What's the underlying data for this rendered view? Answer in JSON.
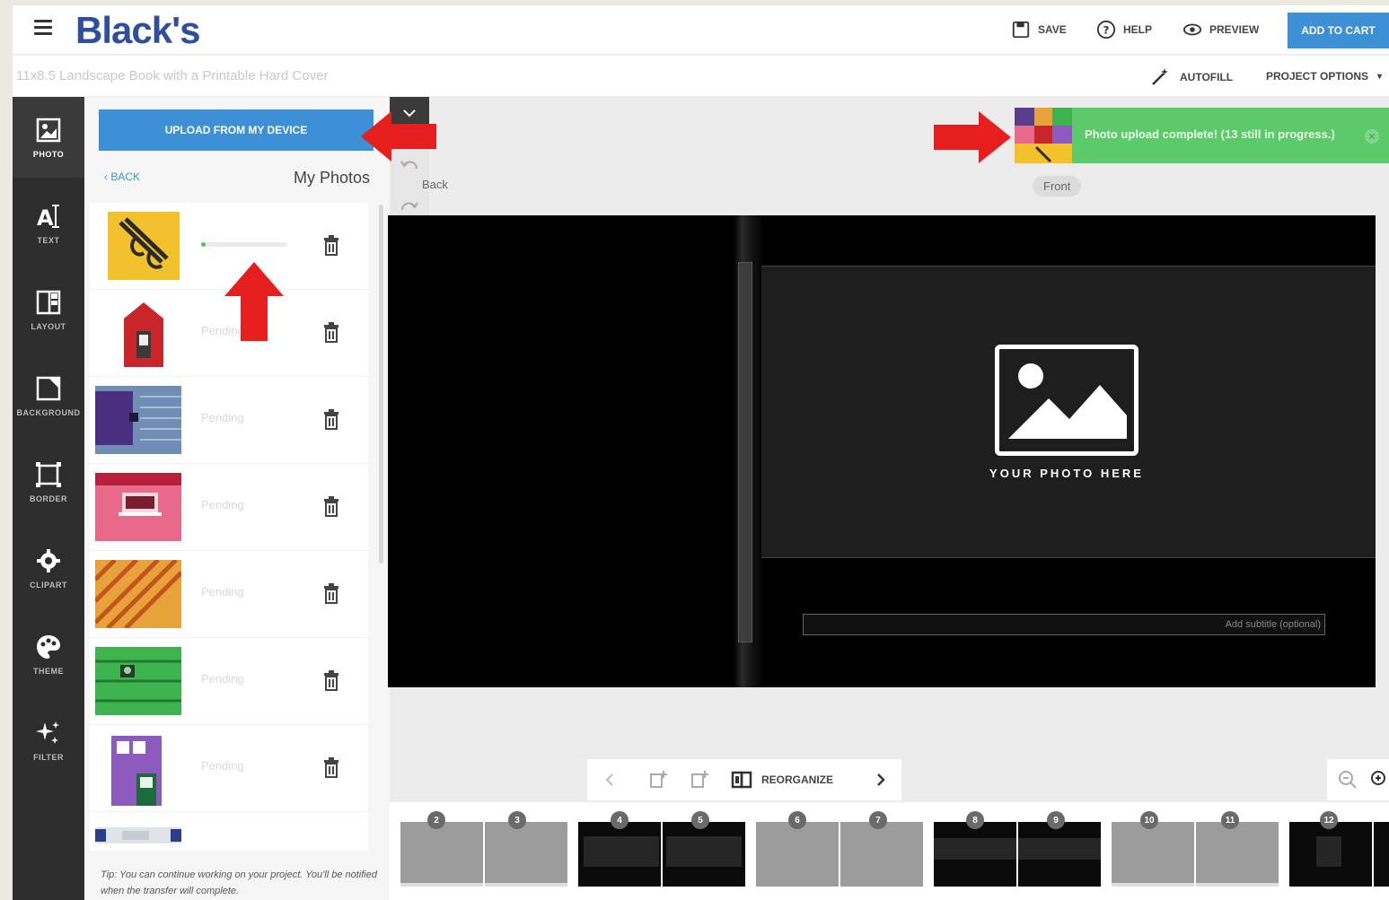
{
  "header": {
    "logo": "Black's",
    "save_label": "SAVE",
    "help_label": "HELP",
    "preview_label": "PREVIEW",
    "cart_label": "ADD TO CART"
  },
  "subheader": {
    "project_title": "11x8.5 Landscape Book with a Printable Hard Cover",
    "autofill_label": "AUTOFILL",
    "project_options_label": "PROJECT OPTIONS"
  },
  "rail": {
    "items": [
      {
        "label": "PHOTO",
        "icon": "photo-icon"
      },
      {
        "label": "TEXT",
        "icon": "text-icon"
      },
      {
        "label": "LAYOUT",
        "icon": "layout-icon"
      },
      {
        "label": "BACKGROUND",
        "icon": "background-icon"
      },
      {
        "label": "BORDER",
        "icon": "border-icon"
      },
      {
        "label": "CLIPART",
        "icon": "clipart-icon"
      },
      {
        "label": "THEME",
        "icon": "palette-icon"
      },
      {
        "label": "FILTER",
        "icon": "sparkle-icon"
      }
    ]
  },
  "panel": {
    "upload_label": "UPLOAD FROM MY DEVICE",
    "back_label": "BACK",
    "title": "My Photos",
    "photos": [
      {
        "status": "",
        "progress": 0.05,
        "colors": [
          "#f2c12b",
          "#2a2a2a"
        ]
      },
      {
        "status": "Pending",
        "colors": [
          "#ffffff",
          "#c8262b"
        ]
      },
      {
        "status": "Pending",
        "colors": [
          "#5a3d8e",
          "#6f8db5"
        ]
      },
      {
        "status": "Pending",
        "colors": [
          "#e86a8a",
          "#b81f3a"
        ]
      },
      {
        "status": "Pending",
        "colors": [
          "#e7a33a",
          "#c2551d"
        ]
      },
      {
        "status": "Pending",
        "colors": [
          "#3db44e",
          "#1f7a30"
        ]
      },
      {
        "status": "Pending",
        "colors": [
          "#8c5bbd",
          "#1d6a3a"
        ]
      }
    ],
    "tip": "Tip: You can continue working on your project. You'll be notified when the transfer will complete."
  },
  "canvas": {
    "back_label": "Back",
    "front_label": "Front",
    "placeholder_text": "YOUR PHOTO HERE",
    "subtitle_placeholder": "Add subtitle (optional)"
  },
  "notification": {
    "text": "Photo upload complete! (13 still in progress.)"
  },
  "pager": {
    "reorganize_label": "REORGANIZE"
  },
  "spreads": [
    {
      "left": "2",
      "right": "3",
      "tone": "light"
    },
    {
      "left": "4",
      "right": "5",
      "tone": "dark"
    },
    {
      "left": "6",
      "right": "7",
      "tone": "light"
    },
    {
      "left": "8",
      "right": "9",
      "tone": "dark"
    },
    {
      "left": "10",
      "right": "11",
      "tone": "light"
    },
    {
      "left": "12",
      "right": "",
      "tone": "dark"
    }
  ],
  "colors": {
    "accent": "#3d8fd6",
    "success": "#5cc96b",
    "rail": "#2d2d2d",
    "annotation_arrow": "#e61e1e"
  }
}
